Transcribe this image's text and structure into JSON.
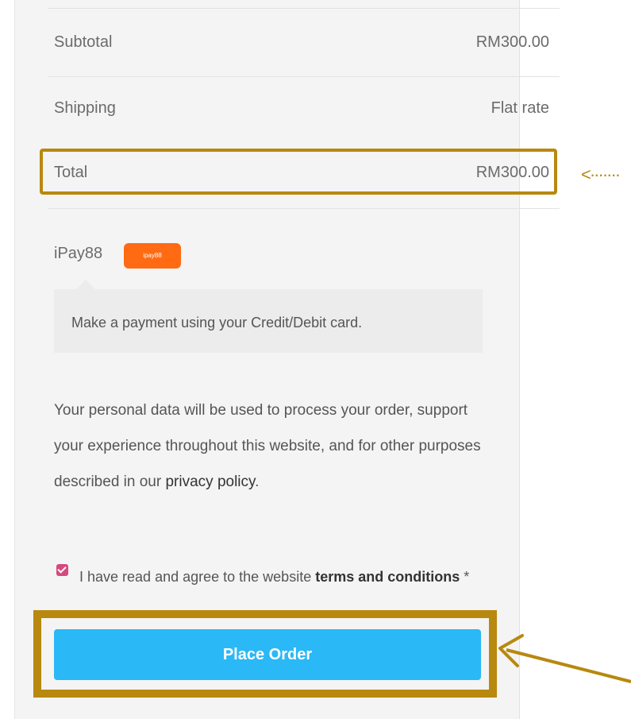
{
  "order_summary": {
    "subtotal_label": "Subtotal",
    "subtotal_value": "RM300.00",
    "shipping_label": "Shipping",
    "shipping_value": "Flat rate",
    "total_label": "Total",
    "total_value": "RM300.00"
  },
  "payment": {
    "method_label": "iPay88",
    "badge_text": "ipay88",
    "description": "Make a payment using your Credit/Debit card."
  },
  "privacy": {
    "text": "Your personal data will be used to process your order, support your experience throughout this website, and for other purposes described in our",
    "link_text": "privacy policy",
    "trailing": "."
  },
  "terms": {
    "prefix": "I have read and agree to the website",
    "link_text": "terms and conditions",
    "required_mark": "*",
    "checked": true
  },
  "actions": {
    "place_order_label": "Place Order"
  },
  "colors": {
    "accent_button": "#2bb8f6",
    "highlight_annotation": "#b8880f",
    "badge": "#ff6a13",
    "checkbox": "#d6497e"
  },
  "icons": {
    "annotation_arrow_small": "dotted-left-arrow-icon",
    "annotation_arrow_large": "left-arrow-icon"
  }
}
